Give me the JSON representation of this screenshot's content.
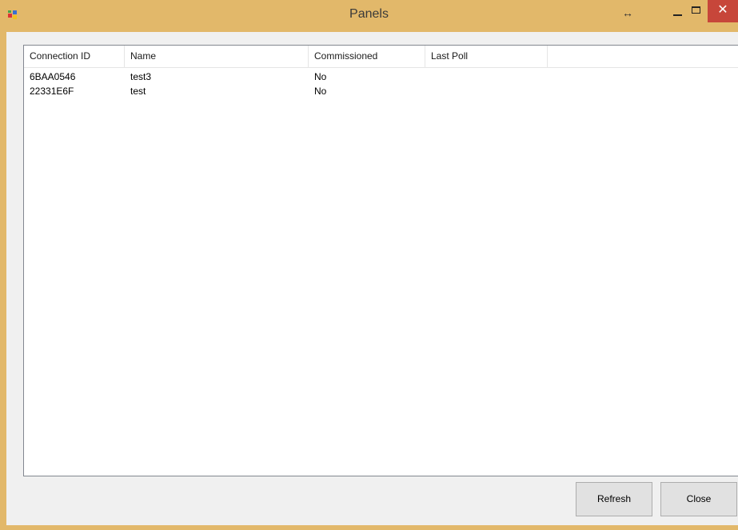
{
  "window": {
    "title": "Panels",
    "resize_glyph": "↔",
    "close_glyph": "✕"
  },
  "listview": {
    "columns": [
      "Connection ID",
      "Name",
      "Commissioned",
      "Last Poll"
    ],
    "rows": [
      [
        "6BAA0546",
        "test3",
        "No",
        ""
      ],
      [
        "22331E6F",
        "test",
        "No",
        ""
      ]
    ]
  },
  "buttons": {
    "refresh": "Refresh",
    "close": "Close"
  },
  "colors": {
    "frame": "#e2b86a",
    "close_button": "#c7463a",
    "client": "#f0f0f0"
  },
  "icons": [
    "app-icon",
    "resize-icon",
    "minimize-icon",
    "maximize-icon",
    "close-icon"
  ]
}
